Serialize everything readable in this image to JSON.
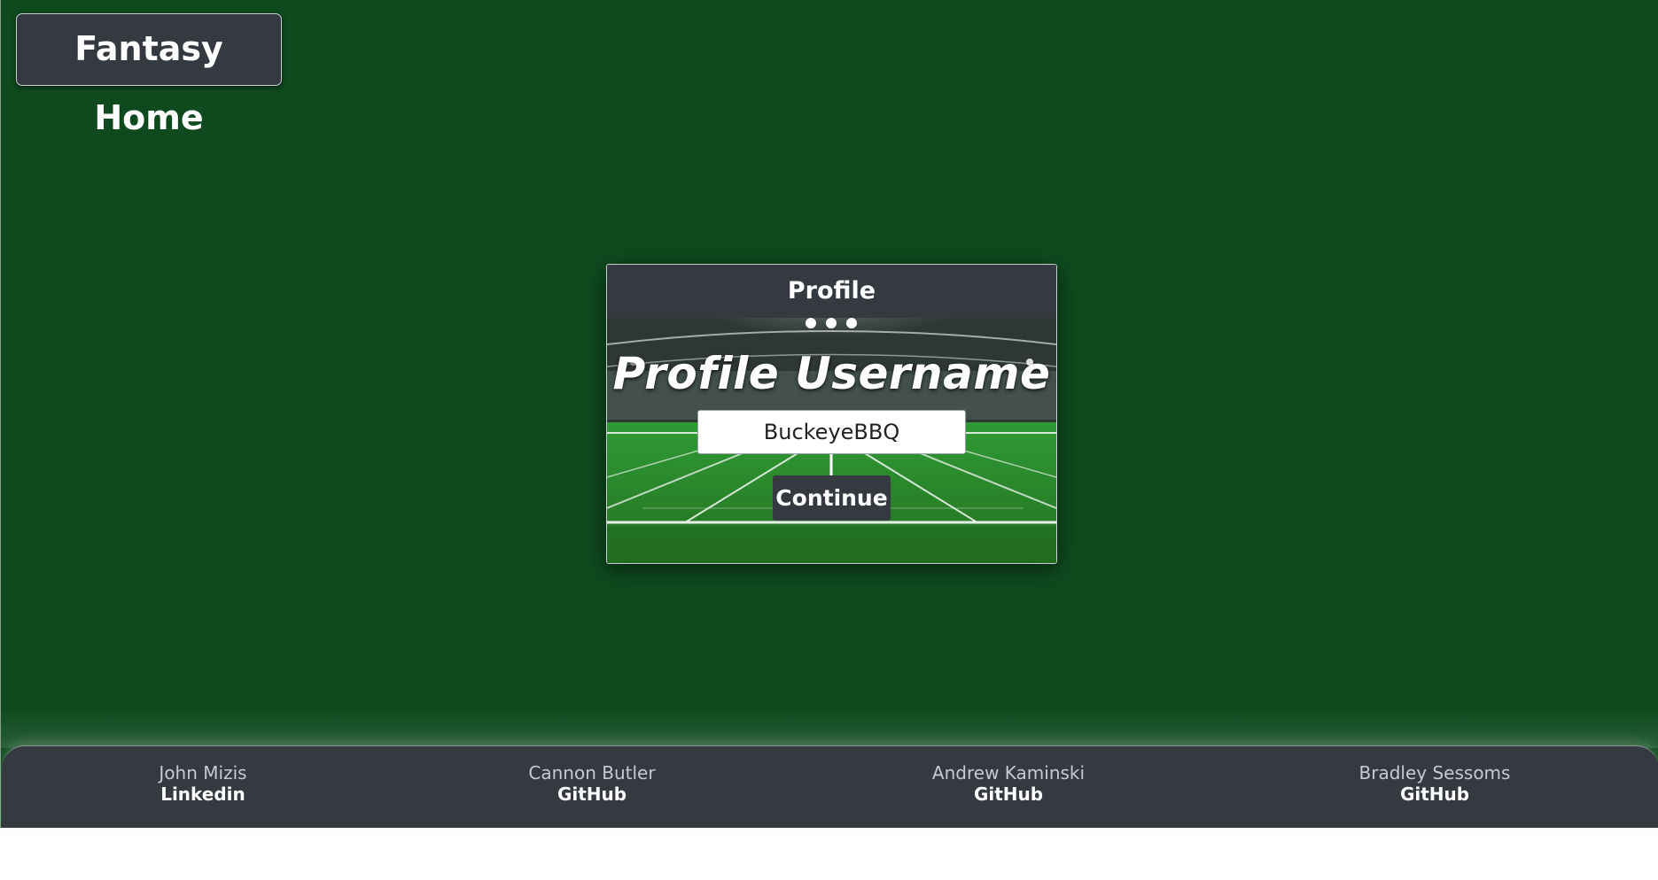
{
  "header": {
    "home_label": "Fantasy Home"
  },
  "profile_card": {
    "header_title": "Profile",
    "heading": "Profile Username",
    "username_value": "BuckeyeBBQ",
    "continue_label": "Continue"
  },
  "footer": {
    "members": [
      {
        "name": "John Mizis",
        "link": "Linkedin"
      },
      {
        "name": "Cannon Butler",
        "link": "GitHub"
      },
      {
        "name": "Andrew Kaminski",
        "link": "GitHub"
      },
      {
        "name": "Bradley Sessoms",
        "link": "GitHub"
      }
    ]
  },
  "colors": {
    "page_background": "#0f4a1e",
    "panel_dark": "#343a40",
    "text_light": "#ffffff"
  }
}
